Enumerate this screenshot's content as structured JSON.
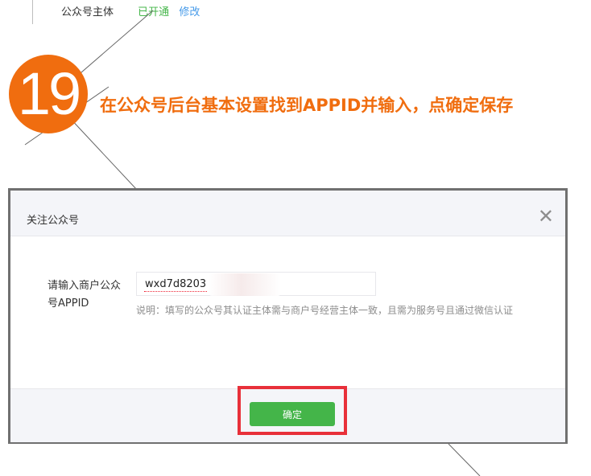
{
  "background_page": {
    "label": "公众号主体",
    "status": "已开通",
    "edit_link": "修改"
  },
  "step": {
    "number": "19",
    "caption": "在公众号后台基本设置找到APPID并输入，点确定保存"
  },
  "dialog": {
    "title": "关注公众号",
    "close_symbol": "✕",
    "field_label": "请输入商户公众号APPID",
    "field_value": "wxd7d8203",
    "hint": "说明：填写的公众号其认证主体需与商户号经营主体一致，且需为服务号且通过微信认证",
    "confirm_label": "确定"
  },
  "colors": {
    "accent_orange": "#f06d0f",
    "confirm_green": "#44b549",
    "highlight_red": "#e8303a"
  }
}
